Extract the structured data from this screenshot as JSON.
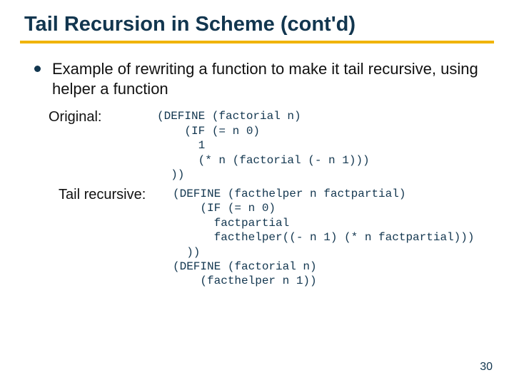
{
  "title": "Tail Recursion in Scheme (cont'd)",
  "bullet": "Example of rewriting a function to make it tail recursive, using helper a function",
  "labels": {
    "original": "Original:",
    "tail": "Tail recursive:"
  },
  "code": {
    "original": "(DEFINE (factorial n)\n    (IF (= n 0)\n      1\n      (* n (factorial (- n 1)))\n  ))",
    "tail": "(DEFINE (facthelper n factpartial)\n    (IF (= n 0)\n      factpartial\n      facthelper((- n 1) (* n factpartial)))\n  ))\n(DEFINE (factorial n)\n    (facthelper n 1))"
  },
  "page_number": "30"
}
